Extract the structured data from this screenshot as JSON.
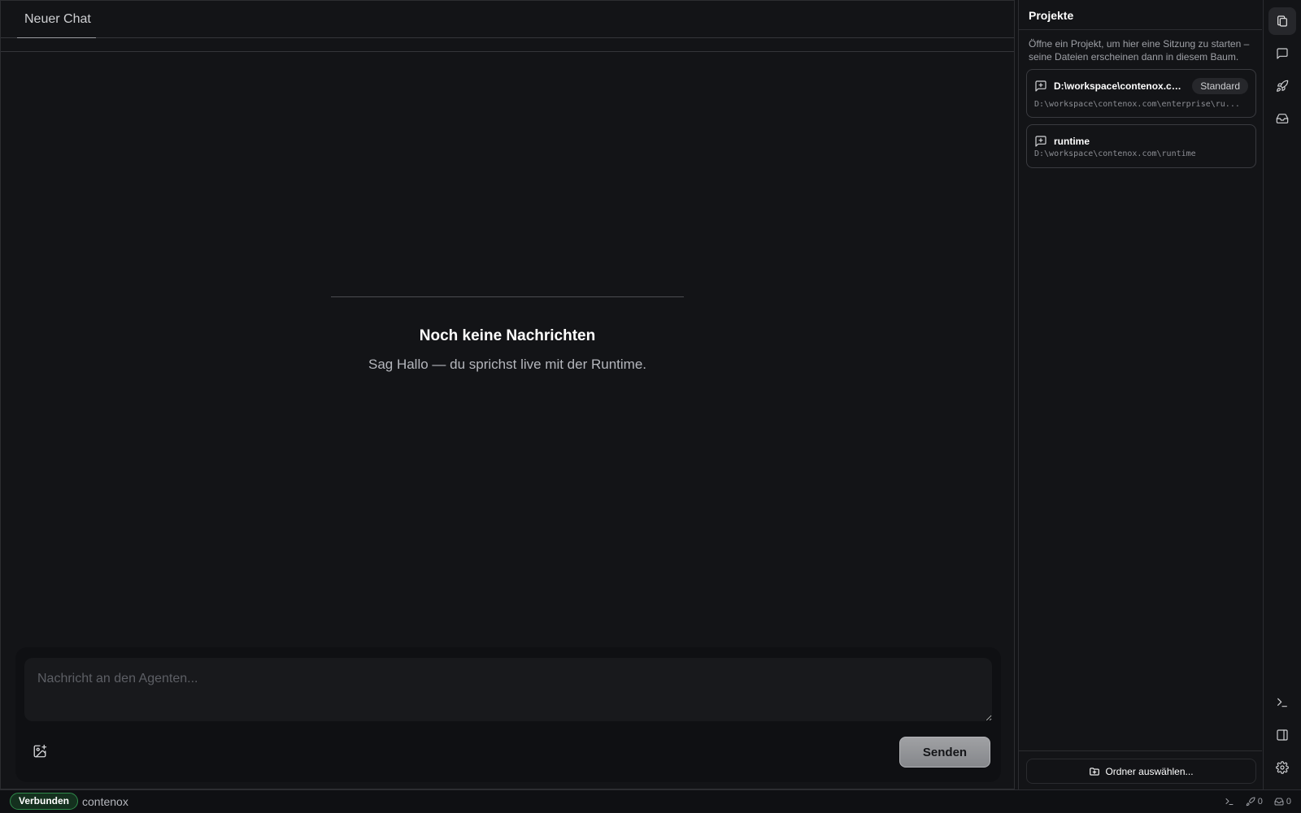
{
  "chat": {
    "tab_label": "Neuer Chat",
    "empty_title": "Noch keine Nachrichten",
    "empty_subtitle": "Sag Hallo — du sprichst live mit der Runtime.",
    "input_placeholder": "Nachricht an den Agenten...",
    "send_label": "Senden"
  },
  "projects": {
    "title": "Projekte",
    "hint": "Öffne ein Projekt, um hier eine Sitzung zu starten – seine Dateien erscheinen dann in diesem Baum.",
    "items": [
      {
        "name": "D:\\workspace\\contenox.co...",
        "badge": "Standard",
        "path": "D:\\workspace\\contenox.com\\enterprise\\ru..."
      },
      {
        "name": "runtime",
        "path": "D:\\workspace\\contenox.com\\runtime"
      }
    ],
    "open_folder_label": "Ordner auswählen..."
  },
  "rail": {
    "icons": [
      "files-icon",
      "chat-icon",
      "rocket-icon",
      "inbox-icon",
      "terminal-icon",
      "panel-icon",
      "gear-icon"
    ]
  },
  "status": {
    "connection": "Verbunden",
    "workspace": "contenox",
    "deploy_count": "0",
    "inbox_count": "0"
  },
  "colors": {
    "background": "#131417",
    "connected": "#2f8a4a",
    "send_button": "#95979b"
  }
}
